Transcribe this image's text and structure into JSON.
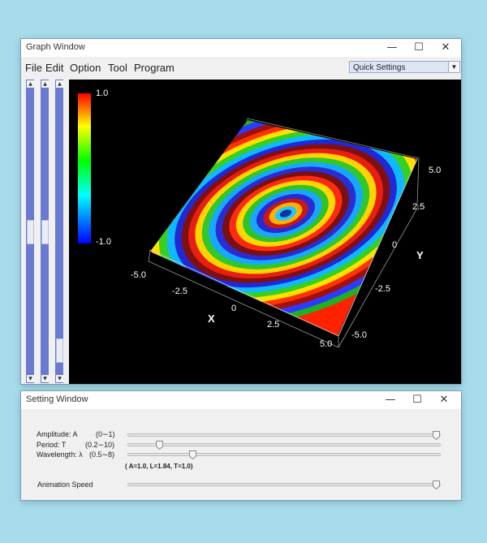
{
  "graph_window": {
    "title": "Graph Window",
    "menu": [
      "File",
      "Edit",
      "Option",
      "Tool",
      "Program"
    ],
    "quick_settings": "Quick Settings",
    "colorbar": {
      "max": "1.0",
      "min": "-1.0"
    },
    "x_ticks": [
      "-5.0",
      "-2.5",
      "0",
      "2.5",
      "5.0"
    ],
    "y_ticks": [
      "-5.0",
      "-2.5",
      "0",
      "2.5",
      "5.0"
    ],
    "x_label": "X",
    "y_label": "Y"
  },
  "setting_window": {
    "title": "Setting Window",
    "rows": [
      {
        "label": "Amplitude: A",
        "range": "(0∼1)",
        "value_fraction": 1.0
      },
      {
        "label": "Period: T",
        "range": "(0.2∼10)",
        "value_fraction": 0.09
      },
      {
        "label": "Wavelength: λ",
        "range": "(0.5∼8)",
        "value_fraction": 0.2
      }
    ],
    "status": "( A=1.0, L=1.84, T=1.0)",
    "animation": {
      "label": "Animation Speed",
      "value_fraction": 1.0
    }
  },
  "colors": {
    "window_border": "#7a9fc2",
    "slider_track": "#6a7ad0",
    "desktop": "#a6dcea"
  }
}
